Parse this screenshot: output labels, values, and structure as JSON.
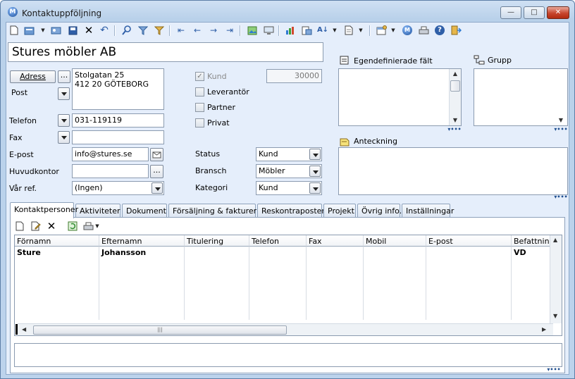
{
  "window": {
    "title": "Kontaktuppföljning",
    "min_label": "—",
    "max_label": "□",
    "close_label": "✕"
  },
  "toolbar": {
    "icons": [
      "new-icon",
      "open-icon",
      "dropdown-arrow",
      "card-icon",
      "save-icon",
      "delete-icon",
      "undo-icon",
      "search-icon",
      "filter-icon",
      "clear-filter-icon",
      "first-icon",
      "prev-icon",
      "next-icon",
      "last-icon",
      "picture-icon",
      "monitor-icon",
      "chart-icon",
      "report-icon",
      "sort-icon",
      "dropdown-arrow",
      "document-icon",
      "dropdown-arrow",
      "settings-icon",
      "dropdown-arrow",
      "logo-icon",
      "print-icon",
      "help-icon",
      "exit-icon"
    ]
  },
  "company_name": "Stures möbler AB",
  "address": {
    "button_label": "Adress",
    "dots_label": "...",
    "type_label": "Post",
    "line1": "Stolgatan 25",
    "line2": "412 20 GÖTEBORG"
  },
  "phone": {
    "label": "Telefon",
    "value": "031-119119"
  },
  "fax": {
    "label": "Fax",
    "value": ""
  },
  "email": {
    "label": "E-post",
    "value": "info@stures.se"
  },
  "head_office": {
    "label": "Huvudkontor",
    "value": "",
    "button_label": "..."
  },
  "our_ref": {
    "label": "Vår ref.",
    "value": "(Ingen)"
  },
  "roles": {
    "kund": {
      "label": "Kund",
      "checked": true,
      "number": "30000"
    },
    "leverantor": {
      "label": "Leverantör"
    },
    "partner": {
      "label": "Partner"
    },
    "privat": {
      "label": "Privat"
    }
  },
  "status": {
    "label": "Status",
    "value": "Kund"
  },
  "bransch": {
    "label": "Bransch",
    "value": "Möbler"
  },
  "kategori": {
    "label": "Kategori",
    "value": "Kund"
  },
  "custom_fields": {
    "label": "Egendefinierade fält"
  },
  "group": {
    "label": "Grupp"
  },
  "note": {
    "label": "Anteckning"
  },
  "tabs": [
    "Kontaktpersoner",
    "Aktiviteter",
    "Dokument",
    "Försäljning & fakturering",
    "Reskontraposter",
    "Projekt",
    "Övrig info.",
    "Inställningar"
  ],
  "grid": {
    "columns": [
      "Förnamn",
      "Efternamn",
      "Titulering",
      "Telefon",
      "Fax",
      "Mobil",
      "E-post",
      "Befattning"
    ],
    "rows": [
      [
        "Sture",
        "Johansson",
        "",
        "",
        "",
        "",
        "",
        "VD"
      ]
    ]
  }
}
